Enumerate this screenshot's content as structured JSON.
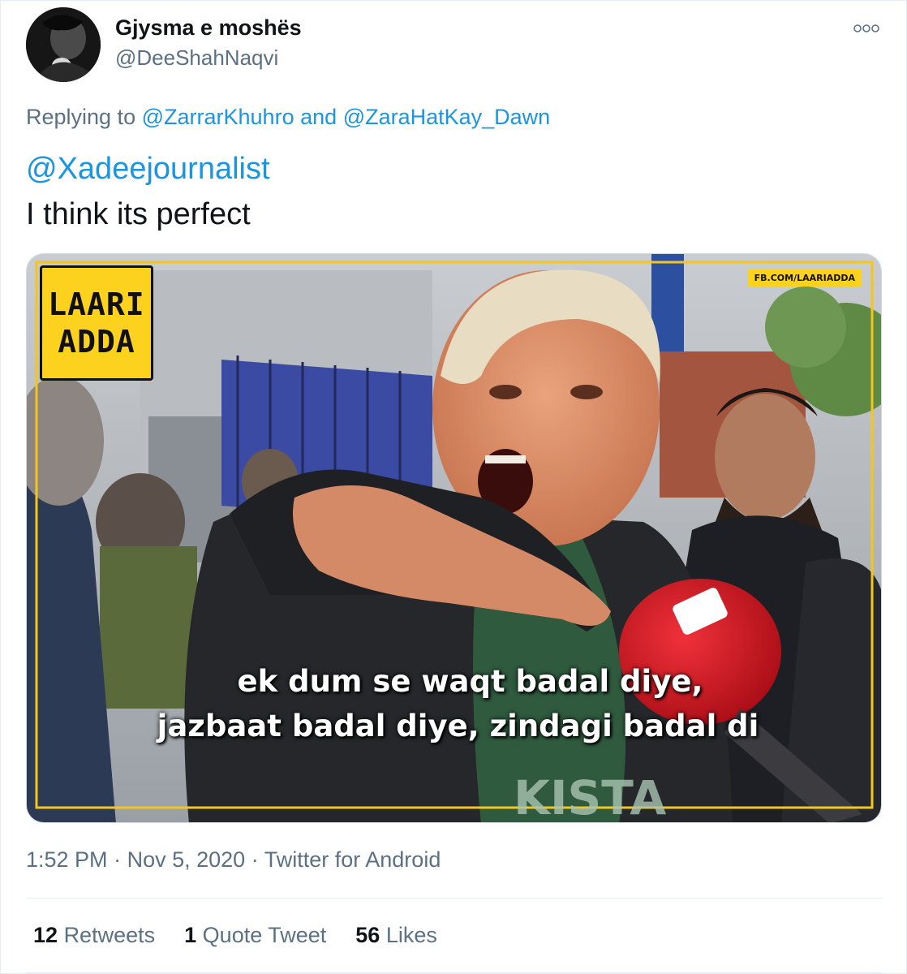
{
  "author": {
    "display_name": "Gjysma e moshës",
    "handle": "@DeeShahNaqvi"
  },
  "more_icon": "more-dots-icon",
  "reply": {
    "prefix": "Replying to",
    "user1": "@ZarrarKhuhro",
    "joiner": "and",
    "user2": "@ZaraHatKay_Dawn"
  },
  "tweet": {
    "mention": "@Xadeejournalist",
    "text": "I think its perfect"
  },
  "media": {
    "logo_line1": "LAARI",
    "logo_line2": "ADDA",
    "watermark": "FB.COM/LAARIADDA",
    "caption_line1": "ek dum se waqt badal diye,",
    "caption_line2": "jazbaat badal diye, zindagi badal di",
    "shirt_text": "KISTA"
  },
  "meta": {
    "time": "1:52 PM",
    "date": "Nov 5, 2020",
    "source": "Twitter for Android",
    "separator": "·"
  },
  "stats": {
    "retweets_count": "12",
    "retweets_label": "Retweets",
    "quotes_count": "1",
    "quotes_label": "Quote Tweet",
    "likes_count": "56",
    "likes_label": "Likes"
  },
  "colors": {
    "link": "#1b95e0",
    "secondary_text": "#5b7083",
    "frame_yellow": "#f5c518"
  }
}
